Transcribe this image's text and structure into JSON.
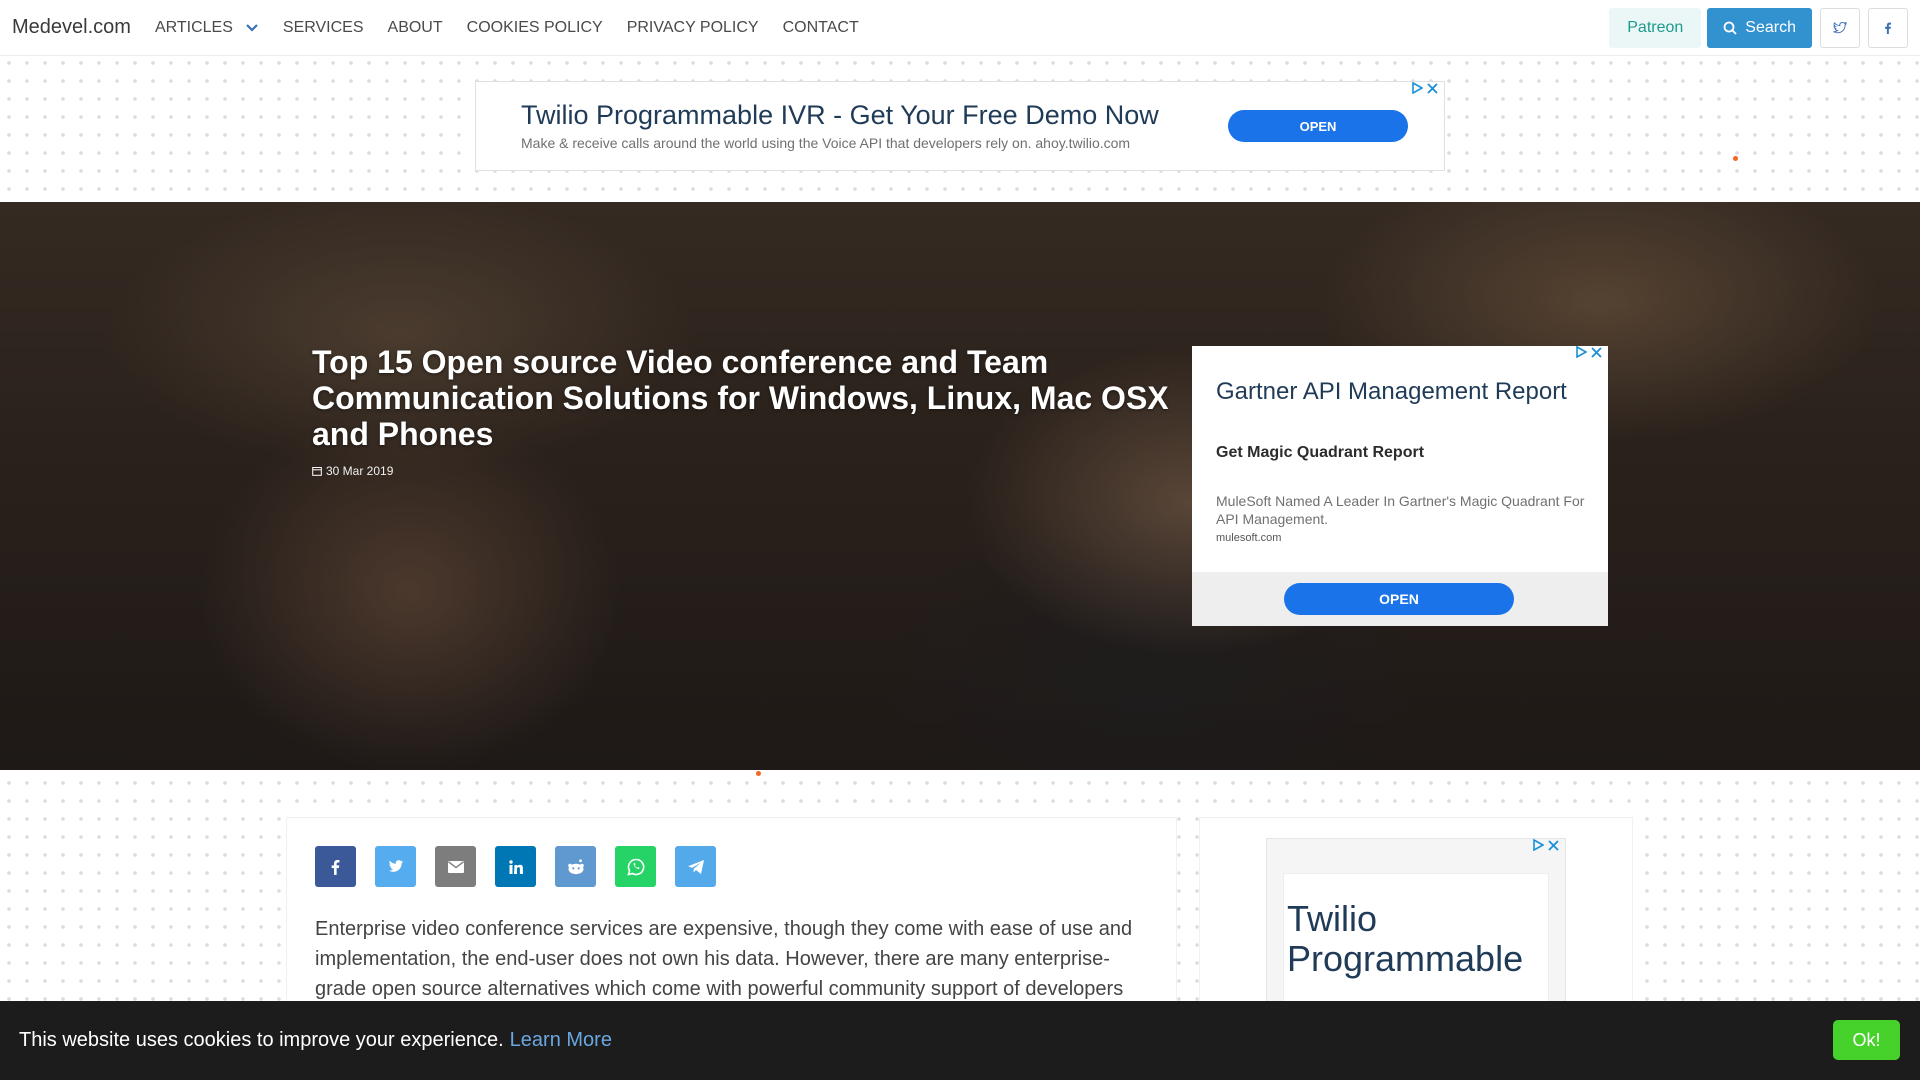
{
  "nav": {
    "brand": "Medevel.com",
    "links": [
      "ARTICLES",
      "SERVICES",
      "ABOUT",
      "COOKIES POLICY",
      "PRIVACY POLICY",
      "CONTACT"
    ],
    "patreon": "Patreon",
    "search": "Search",
    "social": [
      "twitter-icon",
      "facebook-icon"
    ]
  },
  "ad_top": {
    "title": "Twilio Programmable IVR - Get Your Free Demo Now",
    "desc": "Make & receive calls around the world using the Voice API that developers rely on. ahoy.twilio.com",
    "cta": "OPEN"
  },
  "hero": {
    "title": "Top 15 Open source Video conference and Team Communication Solutions for Windows, Linux, Mac OSX and Phones",
    "date": "30 Mar 2019"
  },
  "ad_side": {
    "title": "Gartner API Management Report",
    "sub": "Get Magic Quadrant Report",
    "desc": "MuleSoft Named A Leader In Gartner's Magic Quadrant For API Management.",
    "url": "mulesoft.com",
    "cta": "OPEN"
  },
  "article": {
    "share": [
      "facebook",
      "twitter",
      "email",
      "linkedin",
      "reddit",
      "whatsapp",
      "telegram"
    ],
    "intro": "Enterprise video conference services are expensive, though they come with ease of use and implementation, the end-user does not own his data. However, there are many enterprise-grade open source alternatives which come with powerful community support of developers"
  },
  "ad_small": {
    "title": "Twilio Programmable"
  },
  "cookie": {
    "text": "This website uses cookies to improve your experience.",
    "link": "Learn More",
    "ok": "Ok!"
  },
  "colors": {
    "brand_blue": "#3292d0",
    "patreon_bg": "#ebf7f6",
    "ad_blue": "#1a73e8",
    "cookie_ok": "#46d22b",
    "facebook": "#3b5998",
    "twitter": "#55acee",
    "email": "#7d7d7d",
    "linkedin": "#0077b5",
    "reddit": "#5f99cf",
    "whatsapp": "#25d366",
    "telegram": "#54a9eb"
  }
}
